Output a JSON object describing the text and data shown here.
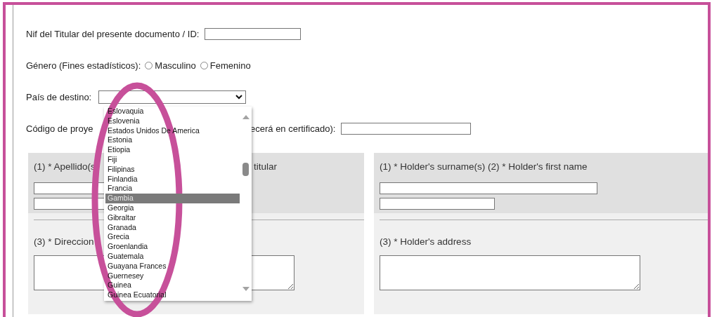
{
  "form": {
    "fields": [
      {
        "kind": "text",
        "label": "Nif del Titular del presente documento / ID:"
      },
      {
        "kind": "radio",
        "label": "Género (Fines estadísticos):",
        "options": [
          {
            "label": "Masculino",
            "selected": false
          },
          {
            "label": "Femenino",
            "selected": false
          }
        ]
      },
      {
        "kind": "select",
        "label": "País de destino:"
      },
      {
        "kind": "split-text",
        "label": "Código de proye",
        "label_end": "ecerá en certificado):"
      }
    ]
  },
  "panels": [
    {
      "heading": "(1) * Apellido(s",
      "heading_end": "titular",
      "address_label": "(3) * Direccion"
    },
    {
      "heading": "(1) * Holder's surname(s) (2) * Holder's first name",
      "address_label": "(3) * Holder's address"
    }
  ],
  "dropdown": {
    "items": [
      {
        "label": "Eslovaquia",
        "selected": false
      },
      {
        "label": "Eslovenia",
        "selected": false
      },
      {
        "label": "Estados Unidos De America",
        "selected": false
      },
      {
        "label": "Estonia",
        "selected": false
      },
      {
        "label": "Etiopia",
        "selected": false
      },
      {
        "label": "Fiji",
        "selected": false
      },
      {
        "label": "Filipinas",
        "selected": false
      },
      {
        "label": "Finlandia",
        "selected": false
      },
      {
        "label": "Francia",
        "selected": false
      },
      {
        "label": "Gambia",
        "selected": true
      },
      {
        "label": "Georgia",
        "selected": false
      },
      {
        "label": "Gibraltar",
        "selected": false
      },
      {
        "label": "Granada",
        "selected": false
      },
      {
        "label": "Grecia",
        "selected": false
      },
      {
        "label": "Groenlandia",
        "selected": false
      },
      {
        "label": "Guatemala",
        "selected": false
      },
      {
        "label": "Guayana Frances",
        "selected": false
      },
      {
        "label": "Guernesey",
        "selected": false
      },
      {
        "label": "Guinea",
        "selected": false
      },
      {
        "label": "Guinea Ecuatorial",
        "selected": false
      }
    ]
  }
}
